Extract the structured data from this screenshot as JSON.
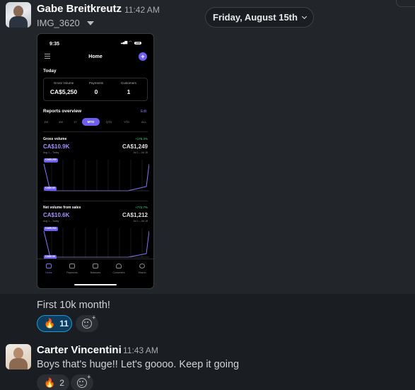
{
  "colors": {
    "background": "#1a1d21",
    "hovered_message": "#222529",
    "accent_purple": "#6f5ff0",
    "reaction_active": "#1d9bd1",
    "positive_green": "#3dd68c"
  },
  "date_divider": {
    "label": "Friday, August 15th",
    "icon": "chevron-down-icon"
  },
  "messages": [
    {
      "author": "Gabe Breitkreutz",
      "time": "11:42 AM",
      "attachment": {
        "name": "IMG_3620",
        "phone": {
          "status_time": "9:35",
          "status_bell": "🔔",
          "status_signal": "▂▄▆",
          "status_wifi": "◠",
          "battery": "100",
          "title": "Home",
          "plus": "+",
          "today_label": "Today",
          "kpis": [
            {
              "label": "Gross Volume",
              "value": "CA$5,250"
            },
            {
              "label": "Payments",
              "value": "0"
            },
            {
              "label": "Customers",
              "value": "1"
            }
          ],
          "reports_title": "Reports overview",
          "edit_label": "Edit",
          "ranges": [
            "1W",
            "4W",
            "1Y",
            "MTD",
            "QTD",
            "YTD",
            "ALL"
          ],
          "active_range": "MTD",
          "gross": {
            "title": "Gross volume",
            "change": "+176.3%",
            "value": "CA$10.9K",
            "compare_value": "CA$1,249",
            "period": "Aug 1 – Today",
            "compare_period": "Jul 1 – Jul 15",
            "tip_high": "CA$5,250",
            "tip_low": "CA$0.00"
          },
          "net": {
            "title": "Net volume from sales",
            "change": "+772.7%",
            "value": "CA$10.6K",
            "compare_value": "CA$1,212",
            "period": "Aug 1 – Today",
            "compare_period": "Jul 1 – Jul 15",
            "tip_high": "CA$5,031",
            "tip_low": "CA$0.00"
          },
          "nav": [
            "Home",
            "Payments",
            "Balances",
            "Customers",
            "Search"
          ]
        }
      },
      "text": "First 10k month!",
      "reactions": [
        {
          "emoji": "🔥",
          "count": "11",
          "active": true
        }
      ]
    },
    {
      "author": "Carter Vincentini",
      "time": "11:43 AM",
      "text": "Boys that's huge!! Let's goooo. Keep it going",
      "reactions": [
        {
          "emoji": "🔥",
          "count": "2",
          "active": false
        }
      ]
    }
  ]
}
